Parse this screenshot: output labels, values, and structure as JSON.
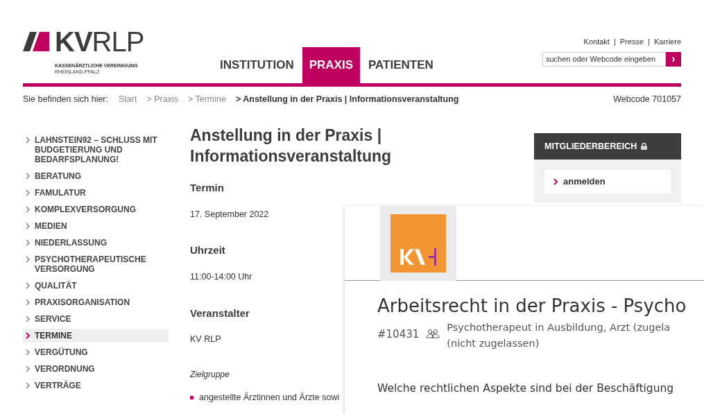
{
  "header": {
    "logo": {
      "wordmark_bold": "KV",
      "wordmark_light": "RLP",
      "line_1": "KASSENÄRZTLICHE VEREINIGUNG",
      "line_2": "RHEINLAND-PFALZ"
    },
    "nav_tabs": [
      {
        "label": "INSTITUTION",
        "selected": false
      },
      {
        "label": "PRAXIS",
        "selected": true
      },
      {
        "label": "PATIENTEN",
        "selected": false
      }
    ],
    "service_links": [
      "Kontakt",
      "Presse",
      "Karriere"
    ],
    "service_separator": "|",
    "search": {
      "placeholder": "suchen oder Webcode eingeben",
      "button": "›"
    }
  },
  "breadcrumb": {
    "label": "Sie befinden sich hier:",
    "items": [
      {
        "text": "Start",
        "current": false
      },
      {
        "text": "> Praxis",
        "current": false
      },
      {
        "text": "> Termine",
        "current": false
      },
      {
        "text": "> Anstellung in der Praxis | Informationsveranstaltung",
        "current": true
      }
    ],
    "webcode": "Webcode 701057"
  },
  "sidebar": {
    "items": [
      {
        "label": "LAHNSTEIN92 – SCHLUSS MIT BUDGETIERUNG UND BEDARFSPLANUNG!",
        "selected": false
      },
      {
        "label": "BERATUNG",
        "selected": false
      },
      {
        "label": "FAMULATUR",
        "selected": false
      },
      {
        "label": "KOMPLEXVERSORGUNG",
        "selected": false
      },
      {
        "label": "MEDIEN",
        "selected": false
      },
      {
        "label": "NIEDERLASSUNG",
        "selected": false
      },
      {
        "label": "PSYCHOTHERAPEUTISCHE VERSORGUNG",
        "selected": false
      },
      {
        "label": "QUALITÄT",
        "selected": false
      },
      {
        "label": "PRAXISORGANISATION",
        "selected": false
      },
      {
        "label": "SERVICE",
        "selected": false
      },
      {
        "label": "TERMINE",
        "selected": true
      },
      {
        "label": "VERGÜTUNG",
        "selected": false
      },
      {
        "label": "VERORDNUNG",
        "selected": false
      },
      {
        "label": "VERTRÄGE",
        "selected": false
      }
    ]
  },
  "content": {
    "title": "Anstellung in der Praxis | Informationsveranstaltung",
    "blocks": [
      {
        "kind": "heading",
        "text": "Termin"
      },
      {
        "kind": "text",
        "text": "17. September 2022"
      },
      {
        "kind": "heading",
        "text": "Uhrzeit"
      },
      {
        "kind": "text",
        "text": "11:00-14:00 Uhr"
      },
      {
        "kind": "heading",
        "text": "Veranstalter"
      },
      {
        "kind": "text",
        "text": "KV RLP"
      },
      {
        "kind": "subheading",
        "text": "Zielgruppe"
      },
      {
        "kind": "bullet",
        "text": "angestellte Ärztinnen und Ärzte sowi"
      }
    ]
  },
  "member_box": {
    "title": "MITGLIEDERBEREICH",
    "link": "anmelden"
  },
  "overlay": {
    "title": "Arbeitsrecht in der Praxis - Psycho",
    "number": "#10431",
    "audience_lines": [
      "Psychotherapeut in Ausbildung, Arzt (zugela",
      "(nicht zugelassen)"
    ],
    "question": "Welche rechtlichen Aspekte sind bei der Beschäftigung"
  }
}
